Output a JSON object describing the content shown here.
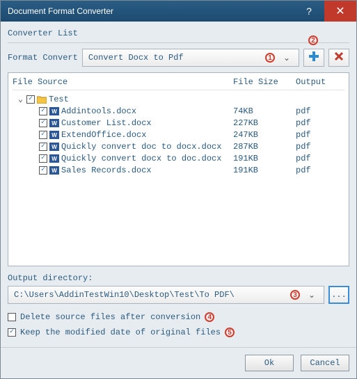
{
  "window": {
    "title": "Document Format Converter"
  },
  "labels": {
    "converter_list": "Converter List",
    "format_convert": "Format Convert",
    "output_directory": "Output directory:",
    "browse": "..."
  },
  "format_select": {
    "value": "Convert Docx to Pdf"
  },
  "columns": {
    "source": "File Source",
    "size": "File Size",
    "output": "Output"
  },
  "root": {
    "name": "Test"
  },
  "files": [
    {
      "name": "Addintools.docx",
      "size": "74KB",
      "output": "pdf"
    },
    {
      "name": "Customer List.docx",
      "size": "227KB",
      "output": "pdf"
    },
    {
      "name": "ExtendOffice.docx",
      "size": "247KB",
      "output": "pdf"
    },
    {
      "name": "Quickly convert doc to docx.docx",
      "size": "287KB",
      "output": "pdf"
    },
    {
      "name": "Quickly convert docx to doc.docx",
      "size": "191KB",
      "output": "pdf"
    },
    {
      "name": "Sales Records.docx",
      "size": "191KB",
      "output": "pdf"
    }
  ],
  "output_dir": {
    "value": "C:\\Users\\AddinTestWin10\\Desktop\\Test\\To PDF\\"
  },
  "opts": {
    "delete_label": "Delete source files after conversion",
    "keep_label": "Keep the modified date of original files"
  },
  "buttons": {
    "ok": "Ok",
    "cancel": "Cancel"
  },
  "badges": {
    "b1": "1",
    "b2": "2",
    "b3": "3",
    "b4": "4",
    "b5": "5"
  }
}
